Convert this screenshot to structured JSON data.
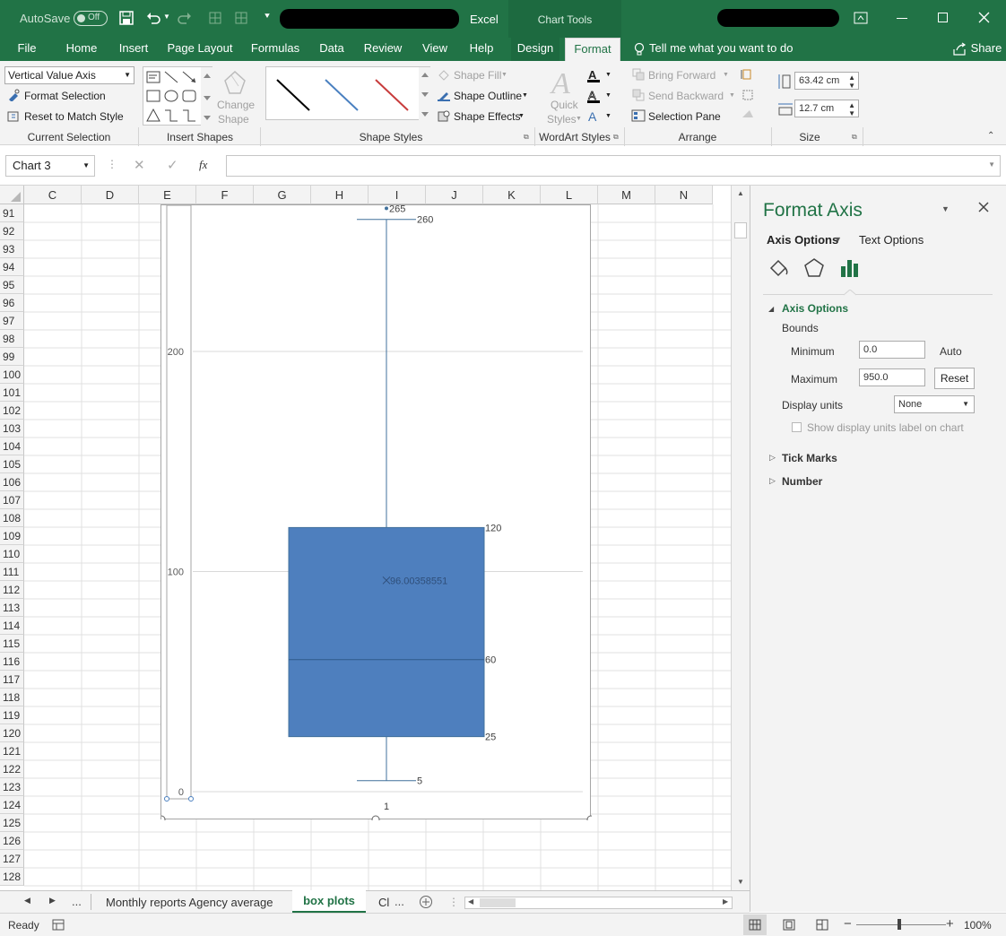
{
  "titlebar": {
    "autosave_label": "AutoSave",
    "autosave_state": "Off",
    "app_name": "Excel",
    "context_tools": "Chart Tools"
  },
  "tabs": {
    "file": "File",
    "home": "Home",
    "insert": "Insert",
    "page_layout": "Page Layout",
    "formulas": "Formulas",
    "data": "Data",
    "review": "Review",
    "view": "View",
    "help": "Help",
    "design": "Design",
    "format": "Format",
    "tell_me": "Tell me what you want to do",
    "share": "Share"
  },
  "ribbon": {
    "current_selection": {
      "dropdown_value": "Vertical Value Axis",
      "format_selection": "Format Selection",
      "reset_style": "Reset to Match Style",
      "label": "Current Selection"
    },
    "insert_shapes": {
      "change_shape_line1": "Change",
      "change_shape_line2": "Shape",
      "label": "Insert Shapes"
    },
    "shape_styles": {
      "shape_fill": "Shape Fill",
      "shape_outline": "Shape Outline",
      "shape_effects": "Shape Effects",
      "label": "Shape Styles",
      "swatch_colors": [
        "#000000",
        "#4a80c0",
        "#c83c3c"
      ]
    },
    "wordart": {
      "quick_styles_line1": "Quick",
      "quick_styles_line2": "Styles",
      "label": "WordArt Styles"
    },
    "arrange": {
      "bring_forward": "Bring Forward",
      "send_backward": "Send Backward",
      "selection_pane": "Selection Pane",
      "label": "Arrange"
    },
    "size": {
      "height": "63.42 cm",
      "width": "12.7 cm",
      "label": "Size"
    }
  },
  "formula_bar": {
    "name_box": "Chart 3",
    "fx": "fx",
    "formula": ""
  },
  "grid": {
    "columns": [
      "C",
      "D",
      "E",
      "F",
      "G",
      "H",
      "I",
      "J",
      "K",
      "L",
      "M",
      "N"
    ],
    "rows": [
      "91",
      "92",
      "93",
      "94",
      "95",
      "96",
      "97",
      "98",
      "99",
      "100",
      "101",
      "102",
      "103",
      "104",
      "105",
      "106",
      "107",
      "108",
      "109",
      "110",
      "111",
      "112",
      "113",
      "114",
      "115",
      "116",
      "117",
      "118",
      "119",
      "120",
      "121",
      "122",
      "123",
      "124",
      "125",
      "126",
      "127",
      "128"
    ]
  },
  "chart_data": {
    "type": "box",
    "categories": [
      "1"
    ],
    "y_tick_labels": [
      "0",
      "100",
      "200"
    ],
    "visible_y_range": [
      0,
      270
    ],
    "axis_bounds": {
      "min": 0.0,
      "max": 950.0
    },
    "box": {
      "whisker_low": 5,
      "q1": 25,
      "median": 60,
      "q3": 120,
      "whisker_high": 260,
      "mean": 96.00358551,
      "outliers": [
        265
      ]
    },
    "data_labels": {
      "whisker_high": "260",
      "q3": "120",
      "median": "60",
      "q1": "25",
      "whisker_low": "5",
      "mean": "96.00358551",
      "outlier": "265"
    },
    "grid": true,
    "box_color": "#4e7fbe"
  },
  "panel": {
    "title": "Format Axis",
    "axis_options_tab": "Axis Options",
    "text_options_tab": "Text Options",
    "section_axis_options": "Axis Options",
    "bounds_label": "Bounds",
    "minimum_label": "Minimum",
    "minimum_value": "0.0",
    "minimum_state": "Auto",
    "maximum_label": "Maximum",
    "maximum_value": "950.0",
    "reset_button": "Reset",
    "display_units_label": "Display units",
    "display_units_value": "None",
    "show_units_label": "Show display units label on chart",
    "tick_marks": "Tick Marks",
    "number": "Number"
  },
  "sheets": {
    "more_left": "...",
    "tab1": "Monthly reports Agency average",
    "tab2": "box plots",
    "tab3": "Cl",
    "more_right": "..."
  },
  "status": {
    "ready": "Ready",
    "zoom": "100%"
  }
}
